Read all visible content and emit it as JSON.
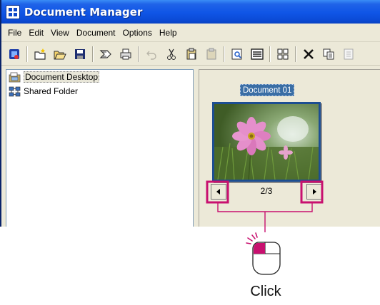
{
  "window": {
    "title": "Document Manager"
  },
  "menu": [
    "File",
    "Edit",
    "View",
    "Document",
    "Options",
    "Help"
  ],
  "toolbar": {
    "buttons": [
      "document-manager-icon",
      "new-folder-icon",
      "open-folder-icon",
      "save-icon",
      "send-icon",
      "print-icon",
      "undo-icon",
      "cut-icon",
      "copy-icon",
      "paste-icon",
      "preview-icon",
      "list-view-icon",
      "thumbnail-view-icon",
      "delete-icon",
      "duplicate-icon",
      "properties-icon"
    ]
  },
  "tree": {
    "items": [
      {
        "label": "Document Desktop",
        "icon": "desktop-folder-icon",
        "selected": true
      },
      {
        "label": "Shared Folder",
        "icon": "shared-folder-icon",
        "selected": false
      }
    ]
  },
  "document": {
    "name": "Document 01",
    "page_indicator": "2/3"
  },
  "annotation": {
    "label": "Click",
    "color": "#C8106F"
  }
}
